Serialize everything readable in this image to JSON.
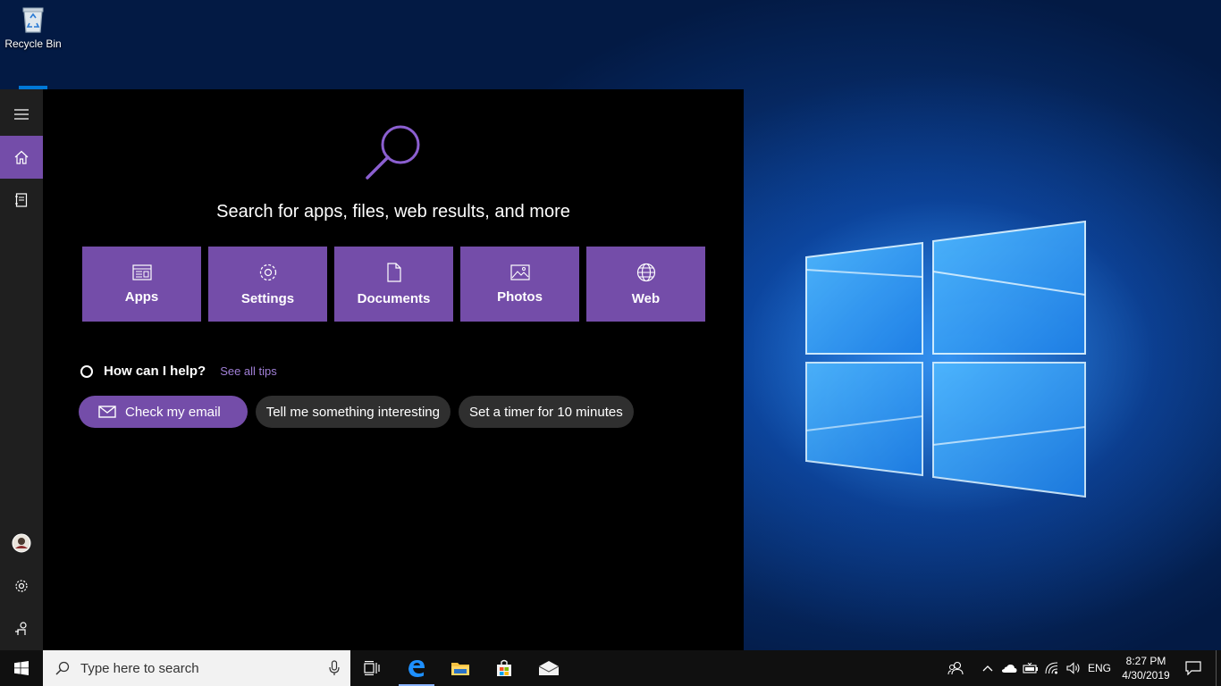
{
  "desktop": {
    "recycle_bin_label": "Recycle Bin"
  },
  "cortana": {
    "headline": "Search for apps, files, web results, and more",
    "tiles": [
      {
        "label": "Apps",
        "icon": "apps-icon"
      },
      {
        "label": "Settings",
        "icon": "gear-icon"
      },
      {
        "label": "Documents",
        "icon": "document-icon"
      },
      {
        "label": "Photos",
        "icon": "photo-icon"
      },
      {
        "label": "Web",
        "icon": "globe-icon"
      }
    ],
    "help_title": "How can I help?",
    "help_link": "See all tips",
    "suggestions": [
      {
        "label": "Check my email",
        "icon": "mail-icon"
      },
      {
        "label": "Tell me something interesting"
      },
      {
        "label": "Set a timer for 10 minutes"
      }
    ],
    "accent_color": "#744da9"
  },
  "taskbar": {
    "search_placeholder": "Type here to search",
    "language": "ENG",
    "time": "8:27 PM",
    "date": "4/30/2019"
  }
}
